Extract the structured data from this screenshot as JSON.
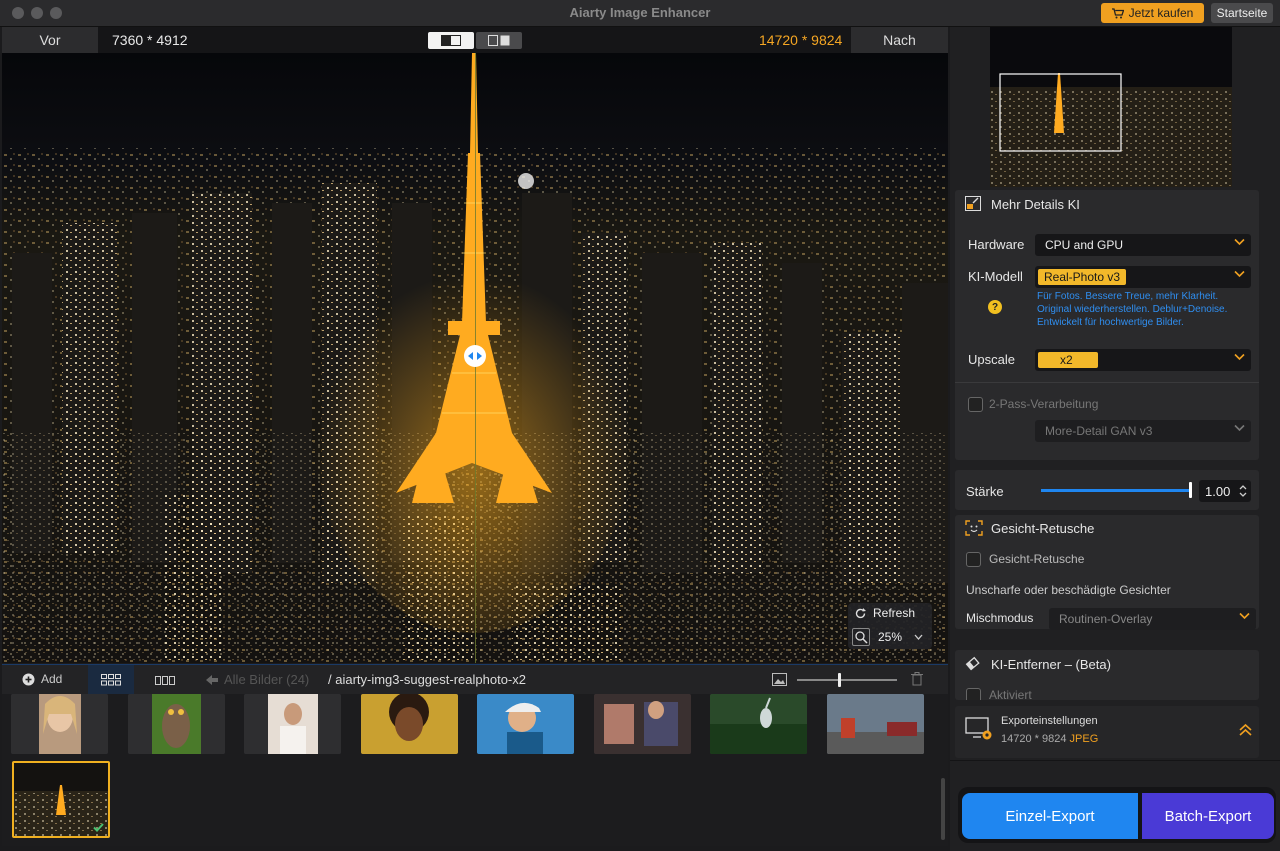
{
  "window": {
    "title": "Aiarty Image Enhancer"
  },
  "titlebar": {
    "buy_label": "Jetzt kaufen",
    "home_label": "Startseite"
  },
  "compare": {
    "before_label": "Vor",
    "before_resolution": "7360 * 4912",
    "after_label": "Nach",
    "after_resolution": "14720 * 9824"
  },
  "zoom": {
    "refresh_label": "Refresh",
    "zoom_value": "25%"
  },
  "thumb_toolbar": {
    "add_label": "Add",
    "back_label": "Alle Bilder (24)",
    "path": "/ aiarty-img3-suggest-realphoto-x2"
  },
  "thumbnails": [
    {
      "subject": "woman portrait"
    },
    {
      "subject": "owl"
    },
    {
      "subject": "woman in white"
    },
    {
      "subject": "woman with curls"
    },
    {
      "subject": "girl with cap"
    },
    {
      "subject": "people at cafe"
    },
    {
      "subject": "heron"
    },
    {
      "subject": "street scene"
    },
    {
      "subject": "tokyo night",
      "selected": true
    }
  ],
  "panel": {
    "section_title": "Mehr Details KI",
    "hardware_label": "Hardware",
    "hardware_value": "CPU and GPU",
    "model_label": "KI-Modell",
    "model_value": "Real-Photo  v3",
    "model_help": "?",
    "model_desc_1": "Für Fotos. Bessere Treue, mehr Klarheit.",
    "model_desc_2": "Original wiederherstellen. Deblur+Denoise.",
    "model_desc_3": "Entwickelt für hochwertige Bilder.",
    "upscale_label": "Upscale",
    "upscale_value": "x2",
    "two_pass_label": "2-Pass-Verarbeitung",
    "two_pass_model": "More-Detail GAN  v3",
    "strength_label": "Stärke",
    "strength_value": "1.00",
    "strength_level": 1.0,
    "face_title": "Gesicht-Retusche",
    "face_check_label": "Gesicht-Retusche",
    "face_desc": "Unscharfe oder beschädigte Gesichter",
    "blend_label": "Mischmodus",
    "blend_value": "Routinen-Overlay",
    "remover_title": "KI-Entferner – (Beta)",
    "remover_check_label": "Aktiviert",
    "export_settings_title": "Exporteinstellungen",
    "export_settings_res": "14720 * 9824",
    "export_settings_format": "JPEG"
  },
  "export": {
    "single_label": "Einzel-Export",
    "batch_label": "Batch-Export"
  },
  "colors": {
    "accent": "#f0a020",
    "blue": "#1f86f0",
    "purple": "#4a3ad6",
    "link": "#2f8ef0"
  }
}
